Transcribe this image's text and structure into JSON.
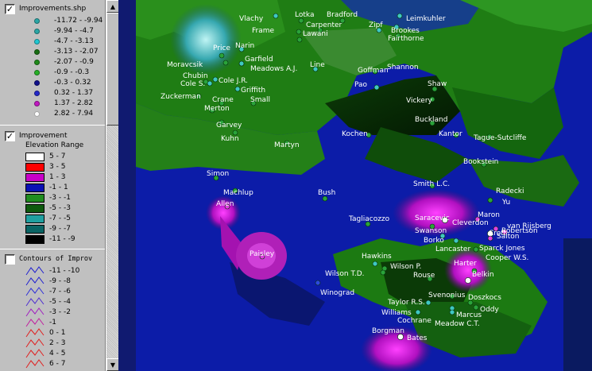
{
  "colors": {
    "panel_bg": "#c0c0c0",
    "map_ocean": "#0a1aa0",
    "terrain_green": "#1f7d14",
    "terrain_dark": "#0a2a06",
    "label_text": "#ffffff",
    "point_fill": "#37b9a8"
  },
  "legend": {
    "layer1": {
      "name": "Improvements.shp",
      "checked": true,
      "check_glyph": "✓",
      "classes": [
        {
          "label": "-11.72 - -9.94",
          "color": "#2aa6a6"
        },
        {
          "label": "-9.94 - -4.7",
          "color": "#2aa6a6"
        },
        {
          "label": "-4.7 - -3.13",
          "color": "#1fc7d2"
        },
        {
          "label": "-3.13 - -2.07",
          "color": "#176e12"
        },
        {
          "label": "-2.07 - -0.9",
          "color": "#1f8a1a"
        },
        {
          "label": "-0.9 - -0.3",
          "color": "#26b026"
        },
        {
          "label": "-0.3 - 0.32",
          "color": "#10108a"
        },
        {
          "label": "0.32 - 1.37",
          "color": "#2428c8"
        },
        {
          "label": "1.37 - 2.82",
          "color": "#c018c0"
        },
        {
          "label": "2.82 - 7.94",
          "color": "#ffffff"
        }
      ]
    },
    "layer2": {
      "name": "Improvement",
      "checked": true,
      "check_glyph": "✓",
      "subtitle": "Elevation Range",
      "classes": [
        {
          "label": "5 - 7",
          "color": "#ffffff"
        },
        {
          "label": "3 - 5",
          "color": "#ff0000"
        },
        {
          "label": "1 - 3",
          "color": "#c800c8"
        },
        {
          "label": "-1 - 1",
          "color": "#0a10b4"
        },
        {
          "label": "-3 - -1",
          "color": "#1f8c1f"
        },
        {
          "label": "-5 - -3",
          "color": "#0e5a0e"
        },
        {
          "label": "-7 - -5",
          "color": "#20a0a0"
        },
        {
          "label": "-9 - -7",
          "color": "#0a6464"
        },
        {
          "label": "-11 - -9",
          "color": "#000000"
        }
      ]
    },
    "layer3": {
      "name": "Contours of Improv",
      "checked": false,
      "classes": [
        {
          "label": "-11 - -10",
          "color": "#2020d0"
        },
        {
          "label": "-9 - -8",
          "color": "#2020d0"
        },
        {
          "label": "-7 - -6",
          "color": "#3030d8"
        },
        {
          "label": "-5 - -4",
          "color": "#5030d0"
        },
        {
          "label": "-3 - -2",
          "color": "#a020c0"
        },
        {
          "label": "-1",
          "color": "#c020a0"
        },
        {
          "label": "0 - 1",
          "color": "#e02020"
        },
        {
          "label": "2 - 3",
          "color": "#e02020"
        },
        {
          "label": "4 - 5",
          "color": "#e02020"
        },
        {
          "label": "6 - 7",
          "color": "#e02020"
        }
      ]
    }
  },
  "scrollbar": {
    "up_glyph": "▲",
    "down_glyph": "▼"
  },
  "points": [
    {
      "label": "Vlachy",
      "type": "cyan"
    },
    {
      "label": "Lotka",
      "type": "green"
    },
    {
      "label": "Bradford",
      "type": "green"
    },
    {
      "label": "Carpenter",
      "type": "green"
    },
    {
      "label": "Leimkuhler",
      "type": "cyan"
    },
    {
      "label": "Frame",
      "type": "green"
    },
    {
      "label": "Lawani",
      "type": "green"
    },
    {
      "label": "Zipf",
      "type": "cyan"
    },
    {
      "label": "Brookes",
      "type": "cyan"
    },
    {
      "label": "Fairthorne",
      "type": "green"
    },
    {
      "label": "Price",
      "type": "green"
    },
    {
      "label": "Narin",
      "type": "cyan"
    },
    {
      "label": "Garfield",
      "type": "cyan"
    },
    {
      "label": "Moravcsik",
      "type": "green"
    },
    {
      "label": "Meadows A.J.",
      "type": "cyan"
    },
    {
      "label": "Line",
      "type": "cyan"
    },
    {
      "label": "Goffman",
      "type": "cyan"
    },
    {
      "label": "Shannon",
      "type": "green"
    },
    {
      "label": "Chubin",
      "type": "green"
    },
    {
      "label": "Cole S.",
      "type": "cyan"
    },
    {
      "label": "Cole J.R.",
      "type": "cyan"
    },
    {
      "label": "Griffith",
      "type": "cyan"
    },
    {
      "label": "Pao",
      "type": "cyan"
    },
    {
      "label": "Shaw",
      "type": "green"
    },
    {
      "label": "Zuckerman",
      "type": "green"
    },
    {
      "label": "Crane",
      "type": "green"
    },
    {
      "label": "Small",
      "type": "green"
    },
    {
      "label": "Vickery",
      "type": "green"
    },
    {
      "label": "Merton",
      "type": "green"
    },
    {
      "label": "Buckland",
      "type": "green"
    },
    {
      "label": "Garvey",
      "type": "green"
    },
    {
      "label": "Kochen",
      "type": "green"
    },
    {
      "label": "Kantor",
      "type": "green"
    },
    {
      "label": "Tague-Sutcliffe",
      "type": "green"
    },
    {
      "label": "Kuhn",
      "type": "green"
    },
    {
      "label": "Martyn",
      "type": "green"
    },
    {
      "label": "Bookstein",
      "type": "green"
    },
    {
      "label": "Simon",
      "type": "green"
    },
    {
      "label": "Smith L.C.",
      "type": "green"
    },
    {
      "label": "Machlup",
      "type": "green"
    },
    {
      "label": "Bush",
      "type": "green"
    },
    {
      "label": "Radecki",
      "type": "green"
    },
    {
      "label": "Allen",
      "type": "magenta"
    },
    {
      "label": "Yu",
      "type": "green"
    },
    {
      "label": "Tagliacozzo",
      "type": "green"
    },
    {
      "label": "Saracevic",
      "type": "white"
    },
    {
      "label": "Cleverdon",
      "type": "white"
    },
    {
      "label": "Maron",
      "type": "magenta"
    },
    {
      "label": "van Rijsberg",
      "type": "magenta"
    },
    {
      "label": "Swanson",
      "type": "green"
    },
    {
      "label": "Croft",
      "type": "white"
    },
    {
      "label": "Robertson",
      "type": "magenta"
    },
    {
      "label": "Salton",
      "type": "magenta"
    },
    {
      "label": "Borko",
      "type": "cyan"
    },
    {
      "label": "Lancaster",
      "type": "cyan"
    },
    {
      "label": "Sparck Jones",
      "type": "green"
    },
    {
      "label": "Paisley",
      "type": "magenta"
    },
    {
      "label": "Hawkins",
      "type": "cyan"
    },
    {
      "label": "Cooper W.S.",
      "type": "green"
    },
    {
      "label": "Wilson P.",
      "type": "green"
    },
    {
      "label": "Harter",
      "type": "green"
    },
    {
      "label": "Wilson T.D.",
      "type": "green"
    },
    {
      "label": "Rouse",
      "type": "green"
    },
    {
      "label": "Belkin",
      "type": "white"
    },
    {
      "label": "Winograd",
      "type": "blue"
    },
    {
      "label": "Svenonius",
      "type": "green"
    },
    {
      "label": "Doszkocs",
      "type": "green"
    },
    {
      "label": "Taylor R.S.",
      "type": "cyan"
    },
    {
      "label": "Oddy",
      "type": "green"
    },
    {
      "label": "Williams",
      "type": "cyan"
    },
    {
      "label": "Marcus",
      "type": "cyan"
    },
    {
      "label": "Cochrane",
      "type": "cyan"
    },
    {
      "label": "Meadow C.T.",
      "type": "cyan"
    },
    {
      "label": "Borgman",
      "type": "white"
    },
    {
      "label": "Bates",
      "type": "white"
    }
  ]
}
